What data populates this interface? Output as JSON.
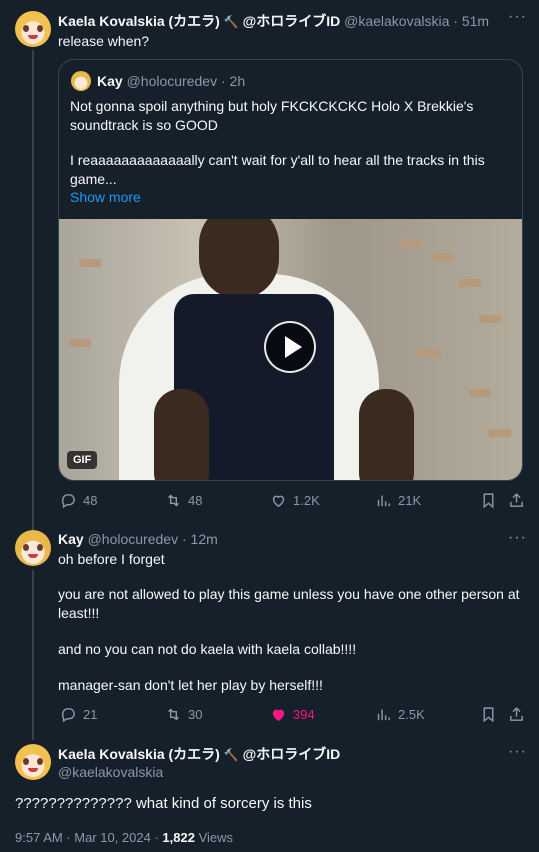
{
  "tweet1": {
    "name": "Kaela Kovalskia (カエラ)",
    "hammer": "🔨",
    "affiliation": "@ホロライブID",
    "handle": "@kaelakovalskia",
    "time": "51m",
    "text": "release when?",
    "quote": {
      "name": "Kay",
      "handle": "@holocuredev",
      "time": "2h",
      "line1": "Not gonna spoil anything but holy FKCKCKCKC Holo X Brekkie's",
      "line2": "soundtrack is so GOOD",
      "line3": "I reaaaaaaaaaaaaally can't wait for y'all to hear all the tracks in this",
      "line4": "game...",
      "show_more": "Show more",
      "gif_label": "GIF"
    },
    "actions": {
      "replies": "48",
      "retweets": "48",
      "likes": "1.2K",
      "views": "21K"
    }
  },
  "tweet2": {
    "name": "Kay",
    "handle": "@holocuredev",
    "time": "12m",
    "line1": "oh before I forget",
    "line2": "you are not allowed to play this game unless you have one other person at",
    "line3": "least!!!",
    "line4": "and no you can not do kaela with kaela collab!!!!",
    "line5": "manager-san don't let her play by herself!!!",
    "actions": {
      "replies": "21",
      "retweets": "30",
      "likes": "394",
      "views": "2.5K"
    }
  },
  "tweet3": {
    "name": "Kaela Kovalskia (カエラ)",
    "hammer": "🔨",
    "affiliation": "@ホロライブID",
    "handle": "@kaelakovalskia",
    "text": "?????????????? what kind of sorcery is this",
    "timestamp": "9:57 AM · Mar 10, 2024 · ",
    "views_count": "1,822",
    "views_label": " Views"
  },
  "colors": {
    "background": "#15202b",
    "accent": "#1d9bf0",
    "like": "#f91880",
    "muted": "#8b98a5"
  }
}
